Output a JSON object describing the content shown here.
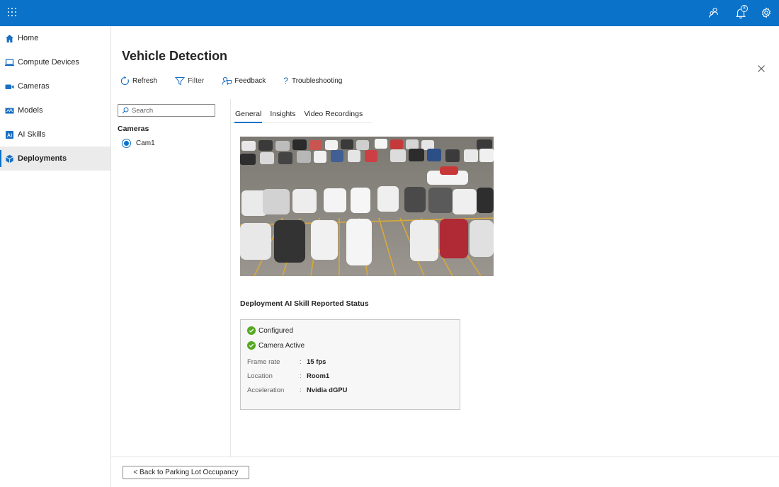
{
  "topbar": {
    "notification_count": "8",
    "icons": [
      "waffle-icon",
      "people-icon",
      "bell-icon",
      "gear-icon"
    ]
  },
  "nav": {
    "items": [
      {
        "label": "Home",
        "icon": "home-icon"
      },
      {
        "label": "Compute Devices",
        "icon": "laptop-icon"
      },
      {
        "label": "Cameras",
        "icon": "camera-icon"
      },
      {
        "label": "Models",
        "icon": "model-icon"
      },
      {
        "label": "AI Skills",
        "icon": "ai-skill-icon"
      },
      {
        "label": "Deployments",
        "icon": "cube-icon",
        "active": true
      }
    ]
  },
  "page": {
    "title": "Vehicle Detection"
  },
  "toolbar": {
    "refresh": "Refresh",
    "filter": "Filter",
    "feedback": "Feedback",
    "troubleshooting": "Troubleshooting"
  },
  "search": {
    "placeholder": "Search"
  },
  "cameras": {
    "heading": "Cameras",
    "items": [
      {
        "label": "Cam1",
        "selected": true
      }
    ]
  },
  "tabs": {
    "general": "General",
    "insights": "Insights",
    "video": "Video Recordings",
    "active": "General"
  },
  "status": {
    "heading": "Deployment AI Skill Reported Status",
    "checks": [
      "Configured",
      "Camera Active"
    ],
    "properties": [
      {
        "key": "Frame rate",
        "sep": ":",
        "value": "15 fps"
      },
      {
        "key": "Location",
        "sep": ":",
        "value": "Room1"
      },
      {
        "key": "Acceleration",
        "sep": ":",
        "value": "Nvidia dGPU"
      }
    ]
  },
  "footer": {
    "back_label": "< Back to Parking Lot Occupancy"
  },
  "colors": {
    "accent": "#0a72c9",
    "success": "#54a920",
    "active_nav": "#ebebeb"
  }
}
